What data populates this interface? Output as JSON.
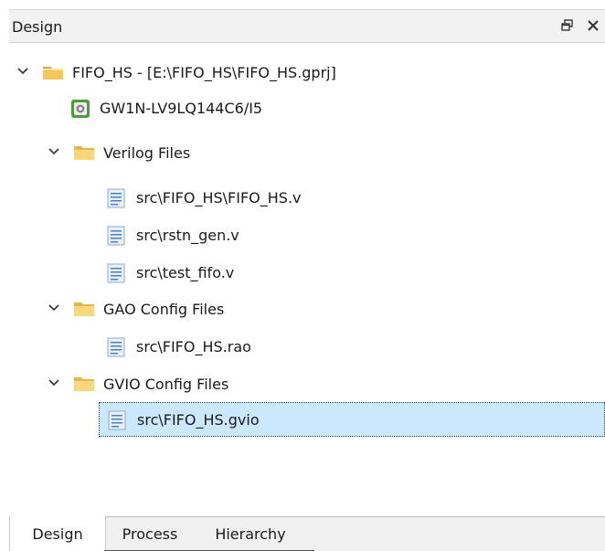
{
  "panel": {
    "title": "Design",
    "restore_icon": "restore-window-icon",
    "close_icon": "close-icon"
  },
  "tree": {
    "project": {
      "label": "FIFO_HS - [E:\\FIFO_HS\\FIFO_HS.gprj]",
      "expanded": true
    },
    "device": {
      "label": "GW1N-LV9LQ144C6/I5"
    },
    "groups": [
      {
        "label": "Verilog Files",
        "expanded": true,
        "files": [
          {
            "label": "src\\FIFO_HS\\FIFO_HS.v"
          },
          {
            "label": "src\\rstn_gen.v"
          },
          {
            "label": "src\\test_fifo.v"
          }
        ]
      },
      {
        "label": "GAO Config Files",
        "expanded": true,
        "files": [
          {
            "label": "src\\FIFO_HS.rao"
          }
        ]
      },
      {
        "label": "GVIO Config Files",
        "expanded": true,
        "files": [
          {
            "label": "src\\FIFO_HS.gvio",
            "selected": true
          }
        ]
      }
    ]
  },
  "tabs": [
    {
      "label": "Design",
      "active": true
    },
    {
      "label": "Process",
      "active": false
    },
    {
      "label": "Hierarchy",
      "active": false
    }
  ],
  "colors": {
    "selection": "#cce8ff",
    "folder": "#f5c84b",
    "file": "#4a7fc1"
  }
}
